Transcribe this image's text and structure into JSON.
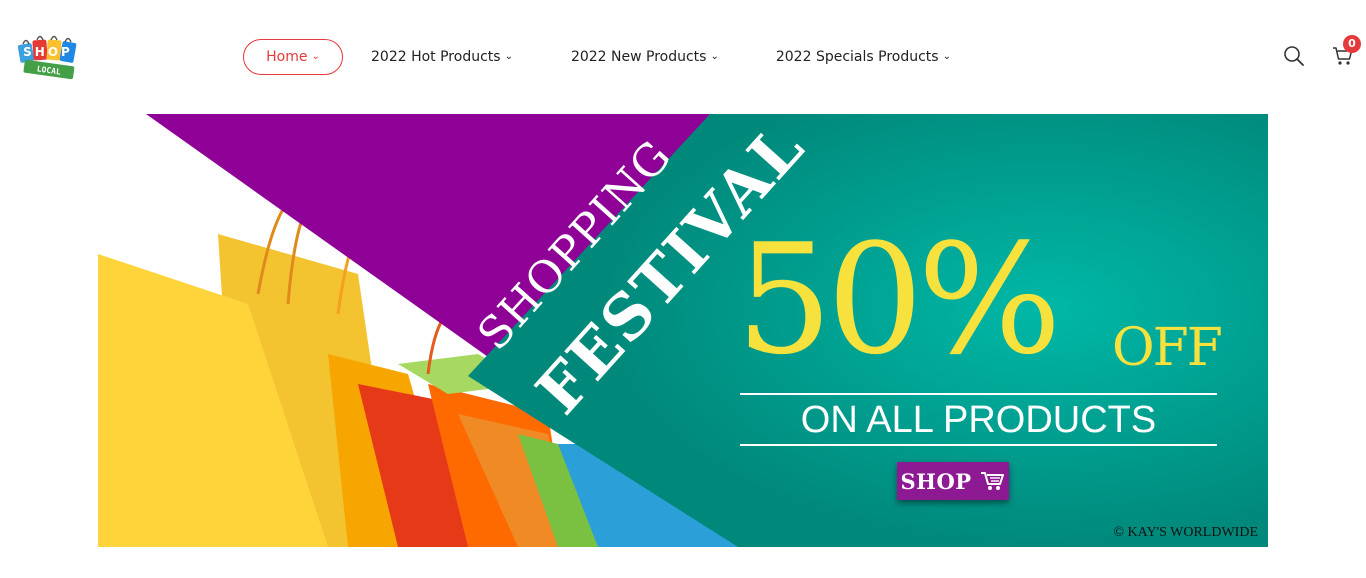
{
  "logo": {
    "top_text": "SHOP",
    "bottom_text": "LOCAL"
  },
  "nav": {
    "items": [
      {
        "label": "Home",
        "active": true
      },
      {
        "label": "2022 Hot Products",
        "active": false
      },
      {
        "label": "2022 New Products",
        "active": false
      },
      {
        "label": "2022 Specials Products",
        "active": false
      }
    ]
  },
  "header_icons": {
    "search": "search-icon",
    "cart": "cart-icon",
    "cart_count": "0"
  },
  "banner": {
    "line1": "SHOPPING",
    "line2": "FESTIVAL",
    "discount": "50%",
    "off": "OFF",
    "subtitle": "ON ALL PRODUCTS",
    "button_label": "SHOP",
    "copyright": "© KAY'S WORLDWIDE",
    "colors": {
      "purple": "#8e0096",
      "teal": "#00897b",
      "yellow": "#f6e13d"
    }
  }
}
